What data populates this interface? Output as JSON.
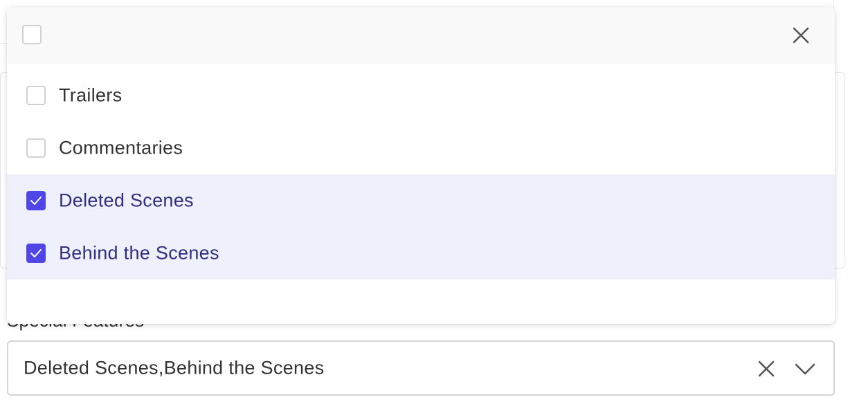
{
  "field": {
    "label": "Special Features",
    "value": "Deleted Scenes,Behind the Scenes"
  },
  "dropdown": {
    "select_all_checked": false,
    "options": [
      {
        "label": "Trailers",
        "checked": false
      },
      {
        "label": "Commentaries",
        "checked": false
      },
      {
        "label": "Deleted Scenes",
        "checked": true
      },
      {
        "label": "Behind the Scenes",
        "checked": true
      }
    ]
  },
  "colors": {
    "accent": "#4f46e5",
    "selected_row_bg": "#eef0fc",
    "selected_text": "#312e81",
    "header_bg": "#f9f9f9"
  },
  "icons": {
    "close": "close-icon",
    "clear": "clear-icon",
    "chevron": "chevron-down-icon",
    "check": "check-icon"
  }
}
